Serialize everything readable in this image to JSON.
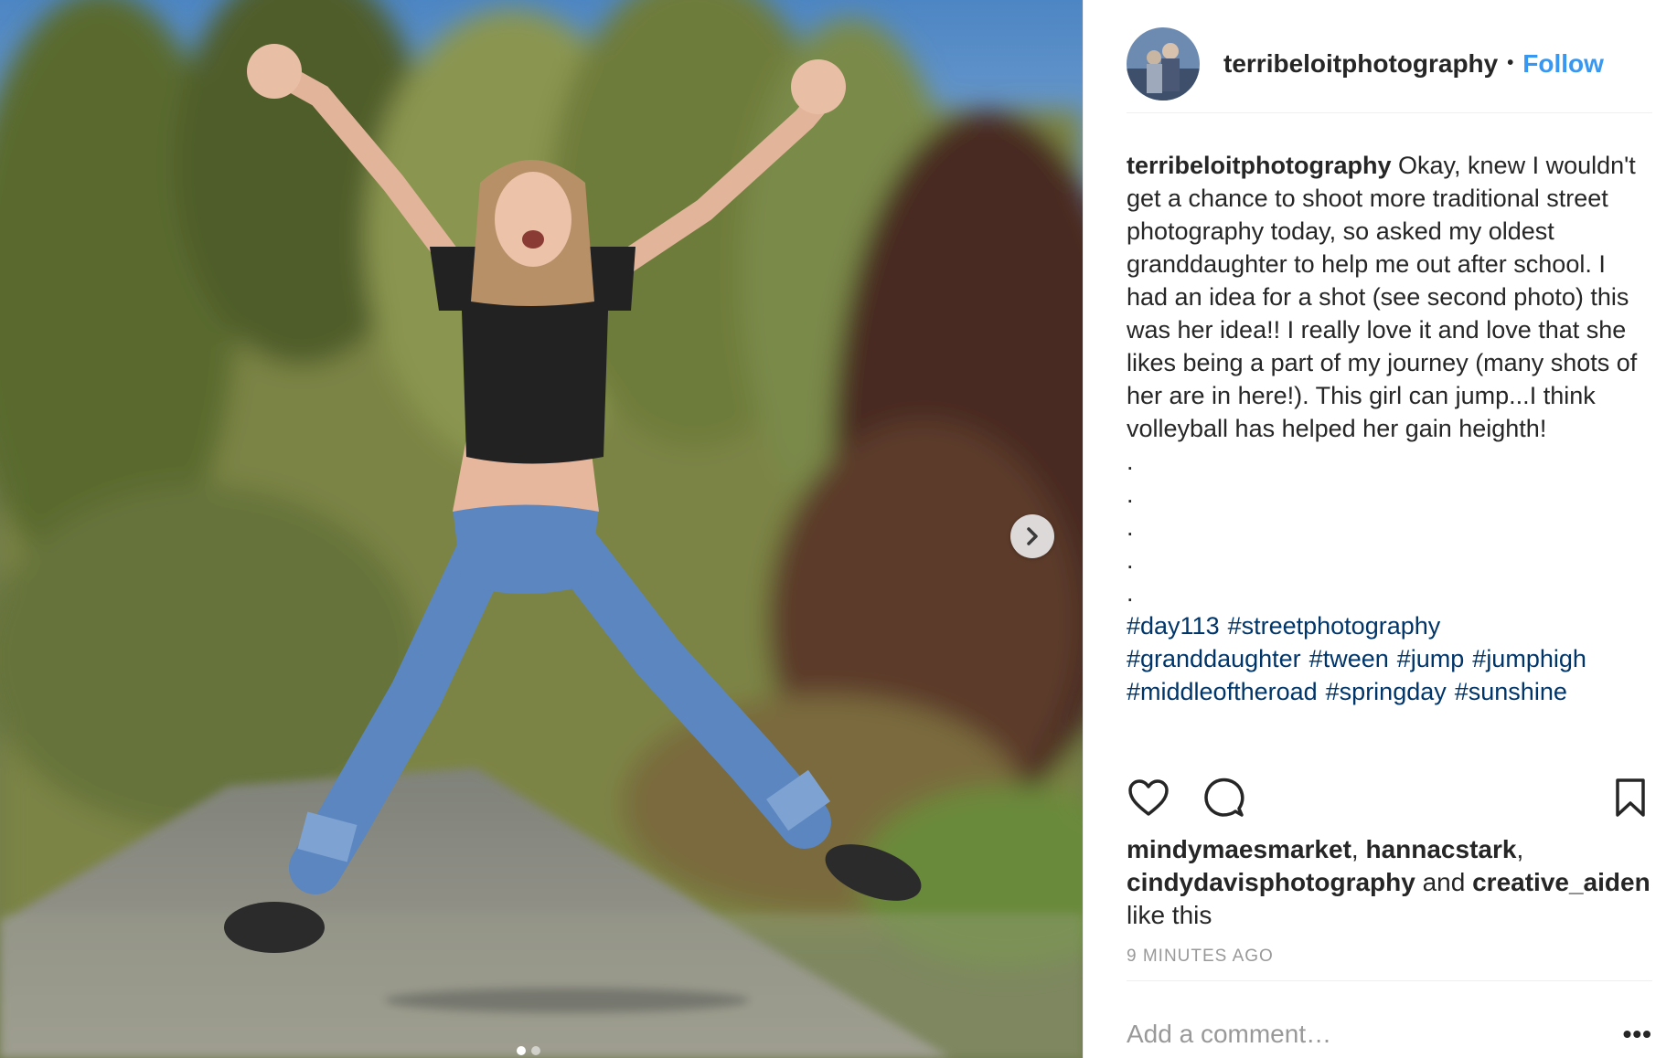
{
  "header": {
    "username": "terribeloitphotography",
    "separator": "•",
    "follow_label": "Follow"
  },
  "caption": {
    "username": "terribeloitphotography",
    "text": "Okay, knew I wouldn't get a chance to shoot more traditional street photography today, so asked my oldest granddaughter to help me out after school. I had an idea for a shot (see second photo) this was her idea!! I really love it and love that she likes being a part of my journey (many shots of her are in here!). This girl can jump...I think volleyball has helped her gain heighth!",
    "dots": [
      ".",
      ".",
      ".",
      ".",
      "."
    ],
    "hashtags": [
      "#day113",
      "#streetphotography",
      "#granddaughter",
      "#tween",
      "#jump",
      "#jumphigh",
      "#middleoftheroad",
      "#springday",
      "#sunshine"
    ]
  },
  "likes": {
    "user1": "mindymaesmarket",
    "sep1": ", ",
    "user2": "hannacstark",
    "sep2": ",",
    "user3": "cindydavisphotography",
    "and": " and ",
    "user4": "creative_aiden",
    "suffix": "like this"
  },
  "timestamp": "9 minutes ago",
  "comment": {
    "placeholder": "Add a comment…",
    "more_label": "•••"
  },
  "carousel": {
    "current": 1,
    "total": 2
  },
  "icons": {
    "next": "chevron-right-icon",
    "like": "heart-icon",
    "comment": "speech-bubble-icon",
    "save": "bookmark-icon"
  },
  "colors": {
    "link": "#3897f0",
    "hashtag": "#003569",
    "muted": "#999999",
    "text": "#262626"
  }
}
